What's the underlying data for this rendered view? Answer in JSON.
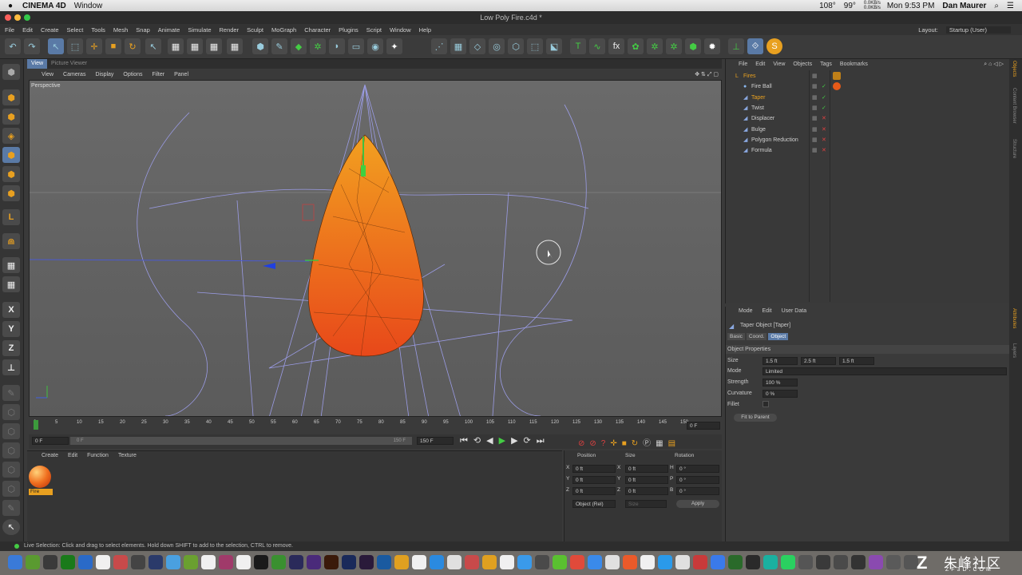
{
  "mac_menubar": {
    "app": "CINEMA 4D",
    "window_menu": "Window",
    "temp": "108°",
    "battery": "99°",
    "net_up": "0.0KB/s",
    "net_down": "0.0KB/s",
    "clock": "Mon 9:53 PM",
    "user": "Dan Maurer"
  },
  "window": {
    "title": "Low Poly Fire.c4d *"
  },
  "main_menu": [
    "File",
    "Edit",
    "Create",
    "Select",
    "Tools",
    "Mesh",
    "Snap",
    "Animate",
    "Simulate",
    "Render",
    "Sculpt",
    "MoGraph",
    "Character",
    "Plugins",
    "Script",
    "Window",
    "Help"
  ],
  "layout": {
    "label": "Layout:",
    "value": "Startup (User)"
  },
  "viewport": {
    "tabs": [
      "View",
      "Picture Viewer"
    ],
    "menu": [
      "View",
      "Cameras",
      "Display",
      "Options",
      "Filter",
      "Panel"
    ],
    "label": "Perspective"
  },
  "timeline": {
    "ticks": [
      "0",
      "5",
      "10",
      "15",
      "20",
      "25",
      "30",
      "35",
      "40",
      "45",
      "50",
      "55",
      "60",
      "65",
      "70",
      "75",
      "80",
      "85",
      "90",
      "95",
      "100",
      "105",
      "110",
      "115",
      "120",
      "125",
      "130",
      "135",
      "140",
      "145",
      "150"
    ],
    "current_frame": "0 F",
    "start": "0 F",
    "range_start": "0 F",
    "range_end": "150 F",
    "end": "150 F"
  },
  "material_manager": {
    "menu": [
      "Create",
      "Edit",
      "Function",
      "Texture"
    ],
    "material_name": "Fire"
  },
  "coordinates": {
    "headers": [
      "Position",
      "Size",
      "Rotation"
    ],
    "rows": [
      {
        "a": "X",
        "p": "0 ft",
        "b": "X",
        "s": "0 ft",
        "c": "H",
        "r": "0 °"
      },
      {
        "a": "Y",
        "p": "0 ft",
        "b": "Y",
        "s": "0 ft",
        "c": "P",
        "r": "0 °"
      },
      {
        "a": "Z",
        "p": "0 ft",
        "b": "Z",
        "s": "0 ft",
        "c": "B",
        "r": "0 °"
      }
    ],
    "mode": "Object (Rel)",
    "size_mode": "Size",
    "apply": "Apply"
  },
  "object_manager": {
    "menu": [
      "File",
      "Edit",
      "View",
      "Objects",
      "Tags",
      "Bookmarks"
    ],
    "objects": [
      "Fires",
      "Fire Ball",
      "Taper",
      "Twist",
      "Displacer",
      "Bulge",
      "Polygon Reduction",
      "Formula"
    ]
  },
  "attribute_manager": {
    "menu": [
      "Mode",
      "Edit",
      "User Data"
    ],
    "object_title": "Taper Object [Taper]",
    "tabs": [
      "Basic",
      "Coord.",
      "Object"
    ],
    "section": "Object Properties",
    "size_label": "Size",
    "size": [
      "1.5 ft",
      "2.5 ft",
      "1.5 ft"
    ],
    "mode_label": "Mode",
    "mode": "Limited",
    "strength_label": "Strength",
    "strength": "100 %",
    "curvature_label": "Curvature",
    "curvature": "0 %",
    "fillet_label": "Fillet",
    "fit_button": "Fit to Parent"
  },
  "side_tabs": [
    "Objects",
    "Content Browser",
    "Structure",
    "Attributes",
    "Layers"
  ],
  "status": "Live Selection: Click and drag to select elements. Hold down SHIFT to add to the selection, CTRL to remove.",
  "watermark": "朱峰社区",
  "watermark_sub": "ZF3D.COM",
  "colors": {
    "fire_top": "#f2a020",
    "fire_bottom": "#e8481a",
    "accent_orange": "#e8a020",
    "wire": "#9b9ce6"
  }
}
